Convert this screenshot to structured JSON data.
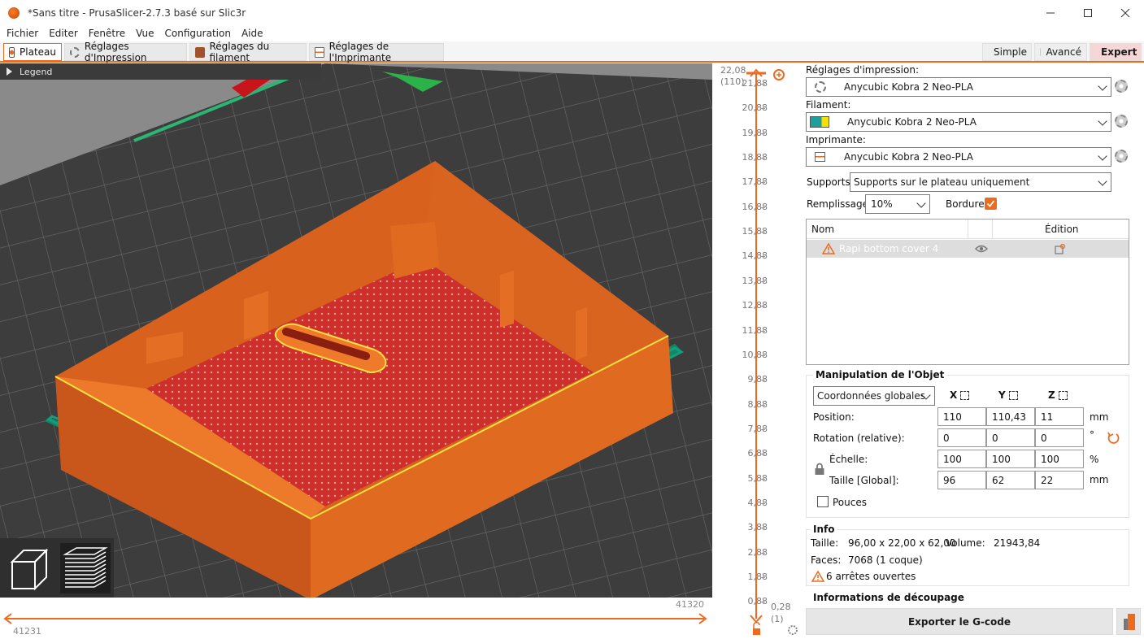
{
  "window": {
    "title": "*Sans titre - PrusaSlicer-2.7.3 basé sur Slic3r"
  },
  "menu": [
    "Fichier",
    "Editer",
    "Fenêtre",
    "Vue",
    "Configuration",
    "Aide"
  ],
  "tabs": [
    "Plateau",
    "Réglages d'Impression",
    "Réglages du filament",
    "Réglages de l'Imprimante"
  ],
  "modes": [
    "Simple",
    "Avancé",
    "Expert"
  ],
  "colors": {
    "accent": "#ed6b21",
    "simple": "#5ac62a",
    "advanced": "#f5d10a",
    "expert": "#e2001a",
    "model": "#e06a20",
    "bed_outline": "#0f8a6a"
  },
  "viewport": {
    "legend": "Legend"
  },
  "hslider": {
    "right_value": "41320",
    "left_value": "41231"
  },
  "vslider": {
    "top_value": "22,08",
    "top_sub": "(110)",
    "ticks": [
      "21,88",
      "20,88",
      "19,88",
      "18,88",
      "17,88",
      "16,88",
      "15,88",
      "14,88",
      "13,88",
      "12,88",
      "11,88",
      "10,88",
      "9,88",
      "8,88",
      "7,88",
      "6,88",
      "5,88",
      "4,88",
      "3,88",
      "2,88",
      "1,88",
      "0,88"
    ],
    "bottom_value": "0,28",
    "bottom_sub": "(1)"
  },
  "sidebar": {
    "print_label": "Réglages d'impression:",
    "print_value": "Anycubic Kobra 2 Neo-PLA",
    "filament_label": "Filament:",
    "filament_value": "Anycubic Kobra 2 Neo-PLA",
    "printer_label": "Imprimante:",
    "printer_value": "Anycubic Kobra 2 Neo-PLA",
    "supports_label": "Supports:",
    "supports_value": "Supports sur le plateau uniquement",
    "infill_label": "Remplissage:",
    "infill_value": "10%",
    "brim_label": "Bordure:",
    "brim_checked": true
  },
  "objects": {
    "col_name": "Nom",
    "col_edit": "Édition",
    "rows": [
      {
        "name": "Rapi bottom cover 4",
        "warning": true
      }
    ]
  },
  "manip": {
    "title": "Manipulation de l'Objet",
    "coord_value": "Coordonnées globales",
    "axes": [
      "X",
      "Y",
      "Z"
    ],
    "rows": [
      {
        "label": "Position:",
        "values": [
          "110",
          "110,43",
          "11"
        ],
        "unit": "mm"
      },
      {
        "label": "Rotation (relative):",
        "values": [
          "0",
          "0",
          "0"
        ],
        "unit": "°"
      },
      {
        "label": "Échelle:",
        "values": [
          "100",
          "100",
          "100"
        ],
        "unit": "%"
      },
      {
        "label": "Taille [Global]:",
        "values": [
          "96",
          "62",
          "22"
        ],
        "unit": "mm"
      }
    ],
    "inches_label": "Pouces"
  },
  "info": {
    "title": "Info",
    "size_label": "Taille:",
    "size_value": "96,00 x 22,00 x 62,00",
    "volume_label": "Volume:",
    "volume_value": "21943,84",
    "faces_label": "Faces:",
    "faces_value": "7068 (1 coque)",
    "warning_text": "6 arrêtes ouvertes"
  },
  "slice_info": {
    "title": "Informations de découpage"
  },
  "export": {
    "label": "Exporter le G-code"
  }
}
